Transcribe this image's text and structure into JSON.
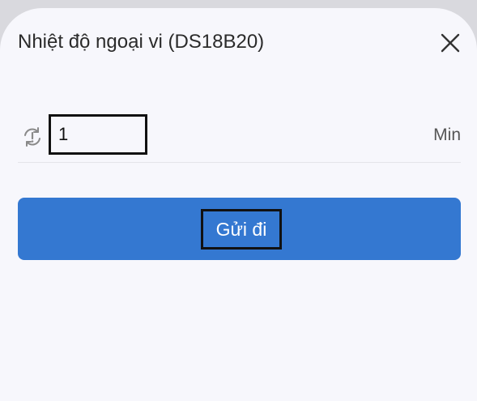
{
  "dialog": {
    "title": "Nhiệt độ ngoại vi (DS18B20)",
    "close_icon": "close-icon"
  },
  "interval_row": {
    "icon": "sync-alert-icon",
    "value": "1",
    "unit": "Min"
  },
  "send_button": {
    "label": "Gửi đi",
    "color": "#3478d1"
  }
}
